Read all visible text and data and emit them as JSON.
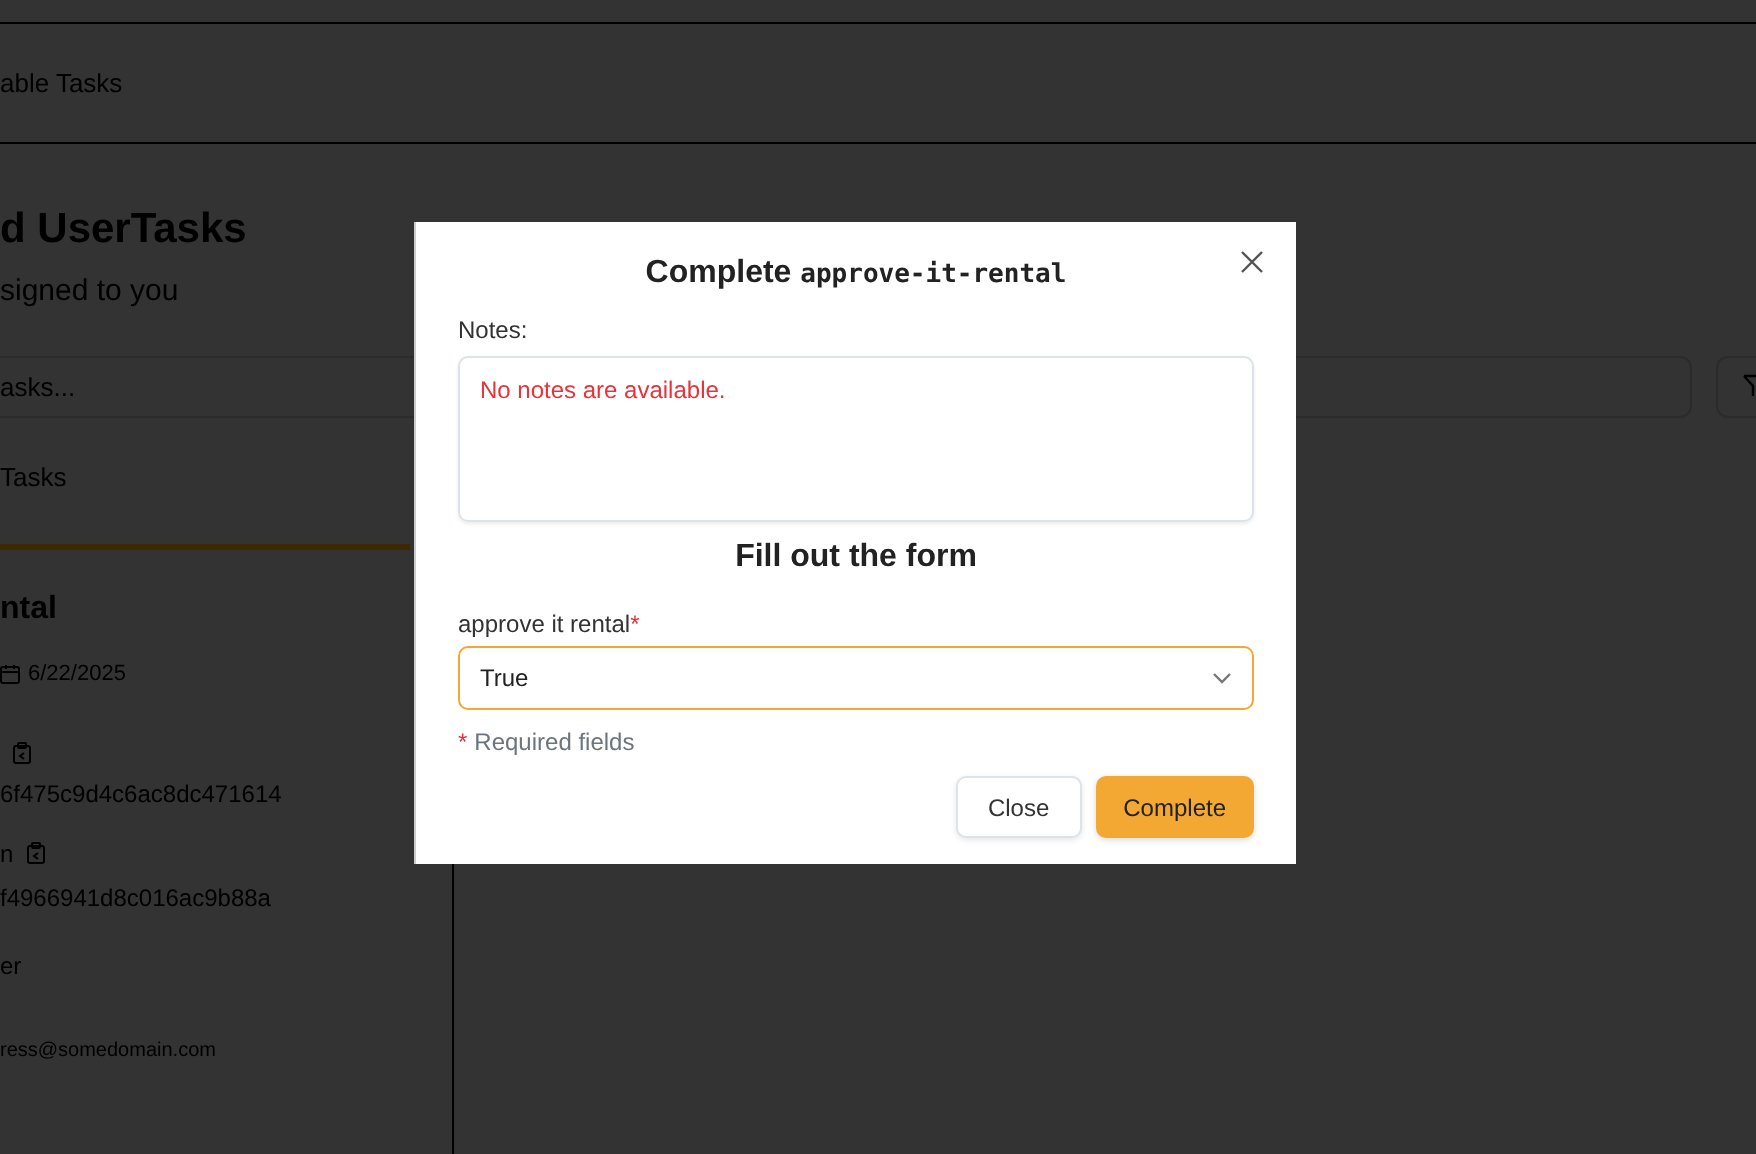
{
  "page": {
    "nav_link": "able Tasks",
    "heading": "d UserTasks",
    "subtitle": "signed to you",
    "search": {
      "placeholder": "asks..."
    },
    "section": "Tasks",
    "task_card": {
      "title": "ntal",
      "date": "6/22/2025",
      "fields": [
        {
          "value": "6f475c9d4c6ac8dc471614"
        },
        {
          "label": "n",
          "value": "f4966941d8c016ac9b88a"
        }
      ],
      "assignee_label": "er",
      "email": "ress@somedomain.com"
    }
  },
  "modal": {
    "title_prefix": "Complete",
    "task_name": "approve-it-rental",
    "notes_label": "Notes:",
    "notes_message": "No notes are available.",
    "form_heading": "Fill out the form",
    "field": {
      "label": "approve it rental",
      "required": true,
      "required_mark": "*",
      "value": "True"
    },
    "required_hint": {
      "mark": "*",
      "text": "Required fields"
    },
    "buttons": [
      {
        "label": "Close",
        "kind": "secondary"
      },
      {
        "label": "Complete",
        "kind": "primary"
      }
    ]
  }
}
